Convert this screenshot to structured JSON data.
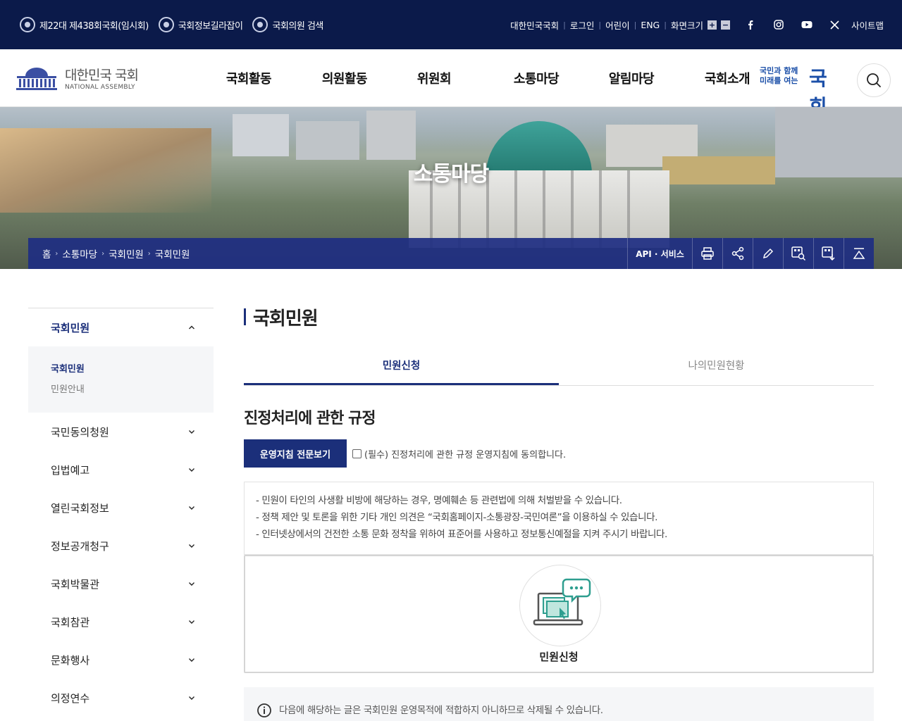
{
  "topbar": {
    "left": [
      "제22대 제438회국회(임시회)",
      "국회정보길라잡이",
      "국회의원 검색"
    ],
    "right": [
      "대한민국국회",
      "로그인",
      "어린이",
      "ENG",
      "화면크기"
    ],
    "zoom_in": "+",
    "zoom_out": "−",
    "social": [
      "facebook-icon",
      "instagram-icon",
      "youtube-icon",
      "x-icon"
    ],
    "sitemap": "사이트맵"
  },
  "header": {
    "logo_name": "대한민국 국회",
    "logo_en": "NATIONAL ASSEMBLY",
    "menu": [
      "국회활동",
      "의원활동",
      "위원회",
      "소통마당",
      "알림마당",
      "국회소개"
    ],
    "slogan_small_1": "국민과 함께",
    "slogan_small_2": "미래를 여는",
    "slogan_big": "국회"
  },
  "banner": {
    "title": "소통마당",
    "breadcrumbs": [
      "홈",
      "소통마당",
      "국회민원",
      "국회민원"
    ],
    "api": "API · 서비스",
    "tools": [
      "print-icon",
      "share-icon",
      "edit-icon",
      "qr-search-icon",
      "download-icon",
      "top-icon"
    ]
  },
  "sidebar": {
    "top": "국회민원",
    "sub": [
      "국회민원",
      "민원안내"
    ],
    "groups": [
      "국민동의청원",
      "입법예고",
      "열린국회정보",
      "정보공개청구",
      "국회박물관",
      "국회참관",
      "문화행사",
      "의정연수"
    ]
  },
  "content": {
    "title": "국회민원",
    "tabs": [
      "민원신청",
      "나의민원현황"
    ],
    "section_title": "진정처리에 관한 규정",
    "guide_button": "운영지침 전문보기",
    "agree_label": "(필수) 진정처리에 관한 규정 운영지침에 동의합니다.",
    "notice": [
      "- 민원이 타인의 사생활 비방에 해당하는 경우, 명예훼손 등 관련법에 의해 처벌받을 수 있습니다.",
      "- 정책 제안 및 토론을 위한 기타 개인 의견은 “국회홈페이지-소통광장-국민여론”을 이용하실 수 있습니다.",
      "- 인터넷상에서의 건전한 소통 문화 정착을 위하여 표준어를 사용하고 정보통신예절을 지켜 주시기 바랍니다."
    ],
    "apply_label": "민원신청",
    "info": "다음에 해당하는 글은 국회민원 운영목적에 적합하지 아니하므로 삭제될 수 있습니다."
  },
  "colors": {
    "navy": "#0b1a4a",
    "accent": "#1b2f7a",
    "teal": "#2e9e8f"
  }
}
